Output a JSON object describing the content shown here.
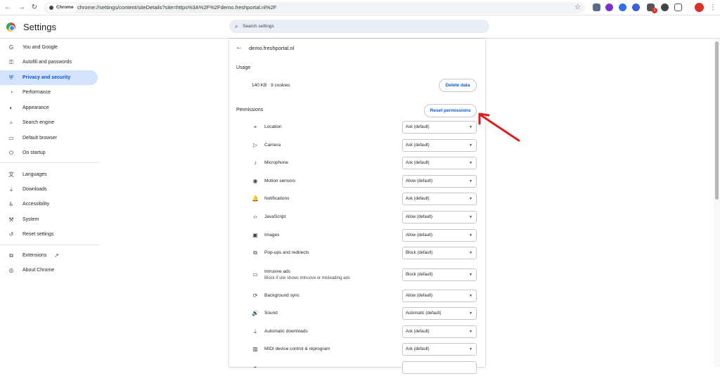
{
  "browser": {
    "chip_label": "Chrome",
    "url": "chrome://settings/content/siteDetails?site=https%3A%2F%2Fdemo.freshportal.nl%2F",
    "ext_badge": "1"
  },
  "header": {
    "title": "Settings",
    "search_placeholder": "Search settings"
  },
  "sidebar": {
    "items": [
      {
        "label": "You and Google",
        "icon": "G"
      },
      {
        "label": "Autofill and passwords",
        "icon": "⚿"
      },
      {
        "label": "Privacy and security",
        "icon": "⛨"
      },
      {
        "label": "Performance",
        "icon": "◔"
      },
      {
        "label": "Appearance",
        "icon": "◐"
      },
      {
        "label": "Search engine",
        "icon": "⌕"
      },
      {
        "label": "Default browser",
        "icon": "▭"
      },
      {
        "label": "On startup",
        "icon": "⏻"
      },
      {
        "label": "Languages",
        "icon": "文"
      },
      {
        "label": "Downloads",
        "icon": "⤓"
      },
      {
        "label": "Accessibility",
        "icon": "♿"
      },
      {
        "label": "System",
        "icon": "⚒"
      },
      {
        "label": "Reset settings",
        "icon": "↺"
      },
      {
        "label": "Extensions",
        "icon": "⧉"
      },
      {
        "label": "About Chrome",
        "icon": "◎"
      }
    ]
  },
  "site": {
    "name": "demo.freshportal.nl",
    "usage_heading": "Usage",
    "usage_value": "140 KB · 9 cookies",
    "delete_label": "Delete data",
    "permissions_heading": "Permissions",
    "reset_label": "Reset permissions"
  },
  "permissions": [
    {
      "label": "Location",
      "value": "Ask (default)",
      "icon": "⌖"
    },
    {
      "label": "Camera",
      "value": "Ask (default)",
      "icon": "▷"
    },
    {
      "label": "Microphone",
      "value": "Ask (default)",
      "icon": "♪"
    },
    {
      "label": "Motion sensors",
      "value": "Allow (default)",
      "icon": "◉"
    },
    {
      "label": "Notifications",
      "value": "Ask (default)",
      "icon": "🔔"
    },
    {
      "label": "JavaScript",
      "value": "Allow (default)",
      "icon": "‹›"
    },
    {
      "label": "Images",
      "value": "Allow (default)",
      "icon": "▣"
    },
    {
      "label": "Pop-ups and redirects",
      "value": "Block (default)",
      "icon": "⧉"
    },
    {
      "label": "Intrusive ads",
      "sublabel": "Block if site shows intrusive or misleading ads",
      "value": "Block (default)",
      "icon": "▭"
    },
    {
      "label": "Background sync",
      "value": "Allow (default)",
      "icon": "⟳"
    },
    {
      "label": "Sound",
      "value": "Automatic (default)",
      "icon": "🔊"
    },
    {
      "label": "Automatic downloads",
      "value": "Ask (default)",
      "icon": "⤓"
    },
    {
      "label": "MIDI device control & reprogram",
      "value": "Ask (default)",
      "icon": "▥"
    }
  ],
  "colors": {
    "accent": "#0b57d0",
    "active_nav_bg": "#d3e3fd",
    "annotation_arrow": "#e01b1b"
  }
}
